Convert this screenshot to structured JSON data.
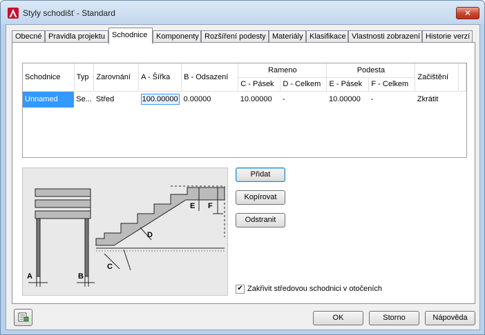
{
  "window": {
    "title": "Styly schodišť - Standard",
    "close_glyph": "✕"
  },
  "tabs": [
    {
      "label": "Obecné"
    },
    {
      "label": "Pravidla projektu"
    },
    {
      "label": "Schodnice",
      "active": true
    },
    {
      "label": "Komponenty"
    },
    {
      "label": "Rozšíření podesty"
    },
    {
      "label": "Materiály"
    },
    {
      "label": "Klasifikace"
    },
    {
      "label": "Vlastnosti zobrazení"
    },
    {
      "label": "Historie verzí"
    }
  ],
  "grid": {
    "headers": {
      "schodnice": "Schodnice",
      "typ": "Typ",
      "zarovnani": "Zarovnání",
      "a": "A - Šířka",
      "b": "B - Odsazení",
      "rameno": "Rameno",
      "c": "C - Pásek",
      "d": "D - Celkem",
      "podesta": "Podesta",
      "e": "E - Pásek",
      "f": "F - Celkem",
      "zacisteni": "Začištění"
    },
    "row": {
      "schodnice": "Unnamed",
      "typ": "Se...",
      "zarovnani": "Střed",
      "a": "100.00000",
      "b": "0.00000",
      "c": "10.00000",
      "d": "-",
      "e": "10.00000",
      "f": "-",
      "zacisteni": "Zkrátit"
    }
  },
  "preview": {
    "labels": [
      "A",
      "B",
      "C",
      "D",
      "E",
      "F"
    ]
  },
  "buttons": {
    "add": "Přidat",
    "copy": "Kopírovat",
    "remove": "Odstranit",
    "ok": "OK",
    "cancel": "Storno",
    "help": "Nápověda"
  },
  "checkbox": {
    "label": "Zakřivit středovou schodnici v otočeních",
    "checked": true,
    "check_glyph": "✔"
  },
  "colors": {
    "accent": "#3399ff",
    "titlebar": "#c2d7ee",
    "app_icon": "#c8102e"
  }
}
